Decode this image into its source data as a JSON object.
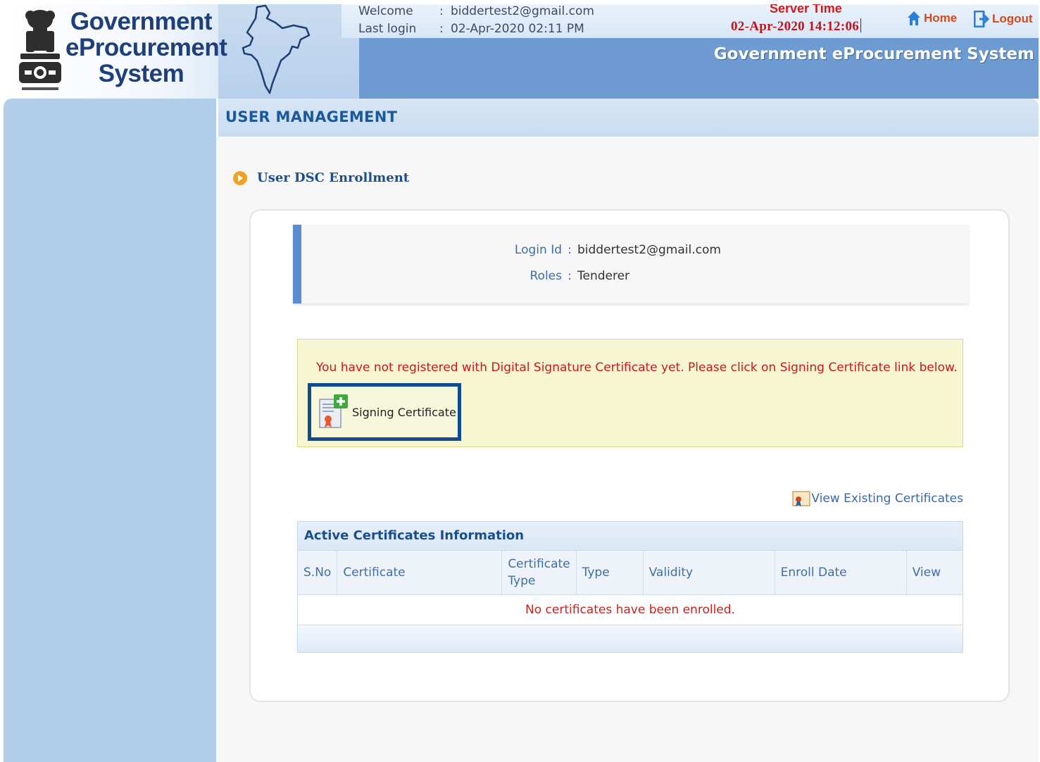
{
  "header": {
    "logo_lines": [
      "Government",
      "eProcurement",
      "System"
    ],
    "welcome_label": "Welcome",
    "welcome_value": "biddertest2@gmail.com",
    "last_login_label": "Last login",
    "last_login_value": "02-Apr-2020 02:11 PM",
    "separator": ":",
    "server_time_label": "Server Time",
    "server_time_value": "02-Apr-2020 14:12:06",
    "home_label": "Home",
    "logout_label": "Logout",
    "system_title": "Government eProcurement System"
  },
  "section": {
    "title": "USER MANAGEMENT",
    "subtitle": "User DSC Enrollment"
  },
  "user_info": {
    "login_id_label": "Login Id",
    "login_id_value": "biddertest2@gmail.com",
    "roles_label": "Roles",
    "roles_value": "Tenderer",
    "colon": ":"
  },
  "warning": {
    "message": "You have not registered with Digital Signature Certificate yet. Please click on Signing Certificate link below.",
    "button_label": "Signing Certificate"
  },
  "view_existing_label": "View Existing Certificates",
  "table": {
    "caption": "Active Certificates Information",
    "columns": [
      "S.No",
      "Certificate",
      "Certificate Type",
      "Type",
      "Validity",
      "Enroll Date",
      "View"
    ],
    "empty_message": "No certificates have been enrolled."
  },
  "colors": {
    "header_blue": "#6e9bd2",
    "sidebar_blue": "#b1cde8",
    "title_blue": "#1a5a9c",
    "alert_red": "#d4141a",
    "highlight_border": "#0e4b8f",
    "nav_orange": "#d54a18"
  },
  "icons": {
    "home": "home-icon",
    "logout": "logout-icon",
    "bullet": "play-bullet-icon",
    "signing": "certificate-add-icon",
    "view_existing": "certificate-icon",
    "emblem": "national-emblem-icon",
    "map": "india-map-icon"
  }
}
